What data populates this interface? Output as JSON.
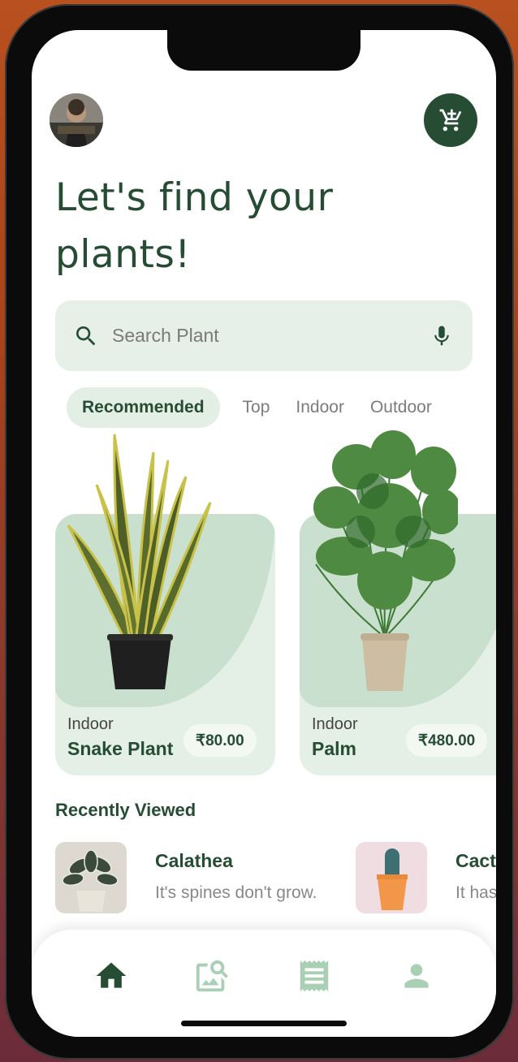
{
  "header": {
    "title": "Let's find your plants!"
  },
  "search": {
    "placeholder": "Search Plant"
  },
  "tabs": [
    {
      "label": "Recommended",
      "active": true
    },
    {
      "label": "Top",
      "active": false
    },
    {
      "label": "Indoor",
      "active": false
    },
    {
      "label": "Outdoor",
      "active": false
    }
  ],
  "products": [
    {
      "category": "Indoor",
      "name": "Snake Plant",
      "price": "₹80.00"
    },
    {
      "category": "Indoor",
      "name": "Palm",
      "price": "₹480.00"
    }
  ],
  "recently_viewed": {
    "heading": "Recently Viewed",
    "items": [
      {
        "name": "Calathea",
        "desc": "It's spines don't grow."
      },
      {
        "name": "Cactus",
        "desc": "It has spines"
      }
    ]
  },
  "colors": {
    "primary": "#264d33",
    "card_bg": "#e4efe6",
    "card_blob": "#c8e0cd",
    "search_bg": "#e6efe8",
    "nav_inactive": "#a9d0b4"
  },
  "icons": {
    "cart": "cart-icon",
    "search": "search-icon",
    "mic": "mic-icon",
    "home": "home-icon",
    "image_search": "image-search-icon",
    "receipt": "receipt-icon",
    "profile": "profile-icon"
  }
}
